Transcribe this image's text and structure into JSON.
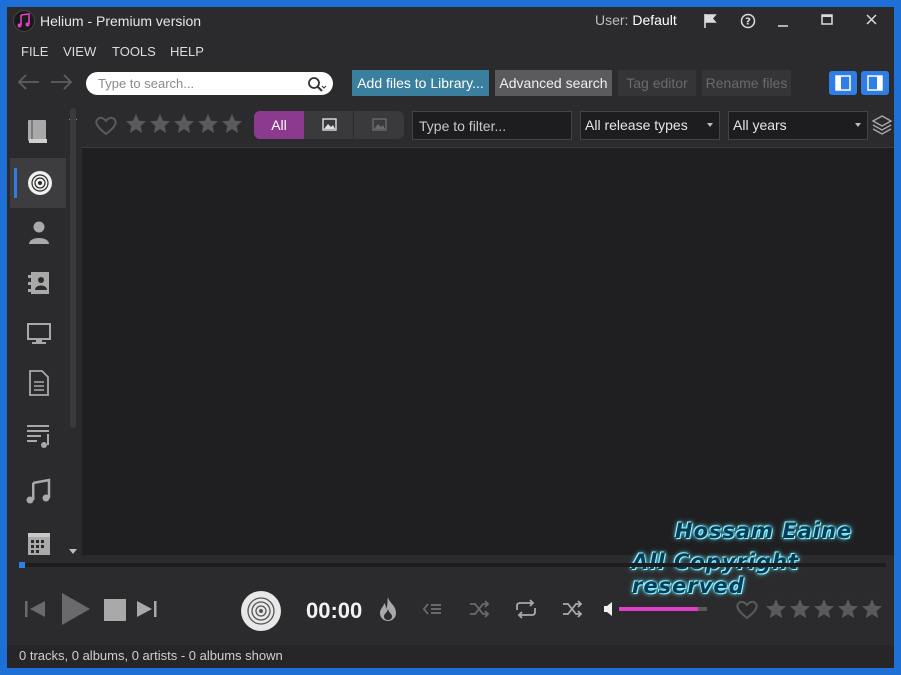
{
  "window": {
    "title": "Helium - Premium version",
    "user_prefix": "User:",
    "user_name": "Default"
  },
  "menu": {
    "file": "FILE",
    "view": "VIEW",
    "tools": "TOOLS",
    "help": "HELP"
  },
  "toolbar": {
    "search_placeholder": "Type to search...",
    "add_files": "Add files to Library...",
    "advanced_search": "Advanced search",
    "tag_editor": "Tag editor",
    "rename_files": "Rename files"
  },
  "sidebar": {
    "items": [
      {
        "icon": "book-icon"
      },
      {
        "icon": "disc-icon",
        "active": true
      },
      {
        "icon": "person-icon"
      },
      {
        "icon": "contact-card-icon"
      },
      {
        "icon": "monitor-icon"
      },
      {
        "icon": "document-icon"
      },
      {
        "icon": "playlist-icon"
      },
      {
        "icon": "music-note-icon"
      },
      {
        "icon": "calendar-icon"
      }
    ]
  },
  "filter_bar": {
    "rating": 0,
    "seg_all": "All",
    "filter_placeholder": "Type to filter...",
    "release_types": "All release types",
    "years": "All years"
  },
  "player": {
    "time": "00:00",
    "progress": 0,
    "volume": 0.9,
    "rating": 0
  },
  "status": {
    "text": "0 tracks, 0 albums, 0 artists - 0 albums shown"
  },
  "watermark": {
    "line1": "Hossam Eaine",
    "line2": "All Copyright reserved"
  },
  "colors": {
    "accent": "#2f7ee8",
    "primary_button": "#3a7f9e",
    "segment_active": "#8b3a8f",
    "volume": "#e040c8"
  }
}
